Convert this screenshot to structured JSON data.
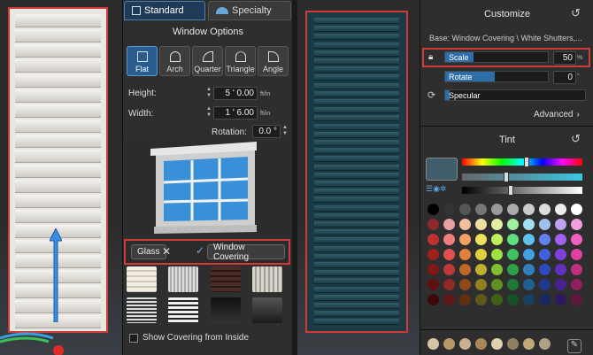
{
  "left_panel": {
    "tabs": [
      {
        "label": "Standard",
        "icon": "window-grid-icon"
      },
      {
        "label": "Specialty",
        "icon": "arch-window-icon"
      }
    ],
    "section_title": "Window Options",
    "shapes": [
      {
        "label": "Flat",
        "active": true
      },
      {
        "label": "Arch",
        "active": false
      },
      {
        "label": "Quarter",
        "active": false
      },
      {
        "label": "Triangle",
        "active": false
      },
      {
        "label": "Angle",
        "active": false
      }
    ],
    "height": {
      "label": "Height:",
      "value": "5 ' 0.00",
      "unit": "ft/in"
    },
    "width": {
      "label": "Width:",
      "value": "1 ' 6.00",
      "unit": "ft/in"
    },
    "rotation": {
      "label": "Rotation:",
      "value": "0.0 °"
    },
    "covering": {
      "glass_label": "Glass",
      "glass_checked": false,
      "window_covering_label": "Window Covering",
      "window_covering_checked": true
    },
    "show_inside_label": "Show Covering from Inside"
  },
  "right_panel": {
    "customize_title": "Customize",
    "base_path": "Base: Window Covering \\ White Shutters,...",
    "scale": {
      "label": "Scale",
      "value": "50",
      "unit": "%",
      "fraction": 0.5
    },
    "rotate": {
      "label": "Rotate",
      "value": "0",
      "unit": "°"
    },
    "specular": {
      "label": "Specular"
    },
    "advanced_label": "Advanced",
    "tint_title": "Tint",
    "tint_color": "#3f5d6a"
  },
  "colors": {
    "accent": "#2d6ea8",
    "highlight_border": "#d23a3a",
    "panel_bg": "#2e2e2e"
  }
}
